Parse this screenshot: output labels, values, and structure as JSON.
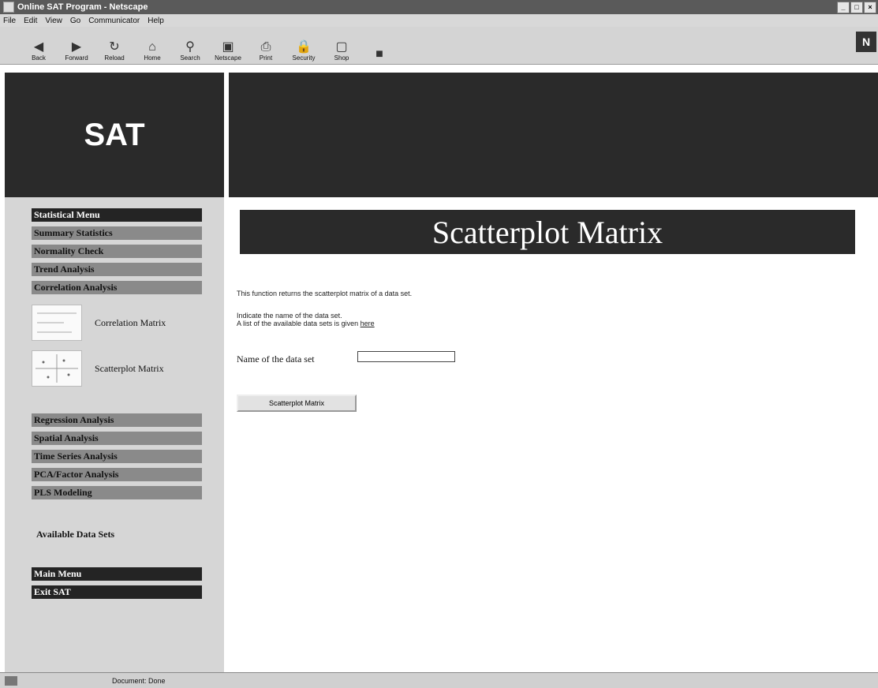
{
  "window": {
    "title": "Online SAT Program - Netscape"
  },
  "menu": [
    "File",
    "Edit",
    "View",
    "Go",
    "Communicator",
    "Help"
  ],
  "toolbar": [
    {
      "label": "Back",
      "icon": "back-arrow-icon"
    },
    {
      "label": "Forward",
      "icon": "forward-arrow-icon"
    },
    {
      "label": "Reload",
      "icon": "reload-icon"
    },
    {
      "label": "Home",
      "icon": "home-icon"
    },
    {
      "label": "Search",
      "icon": "search-icon"
    },
    {
      "label": "Netscape",
      "icon": "netscape-icon"
    },
    {
      "label": "Print",
      "icon": "print-icon"
    },
    {
      "label": "Security",
      "icon": "security-icon"
    },
    {
      "label": "Shop",
      "icon": "shop-icon"
    },
    {
      "label": "",
      "icon": "stop-icon"
    }
  ],
  "brand_logo": "N",
  "header": {
    "logo": "SAT"
  },
  "sidebar": {
    "menu_title": "Statistical Menu",
    "items": [
      "Summary Statistics",
      "Normality Check",
      "Trend Analysis",
      "Correlation Analysis"
    ],
    "sub_items": [
      "Correlation Matrix",
      "Scatterplot Matrix"
    ],
    "items_more": [
      "Regression Analysis",
      "Spatial Analysis",
      "Time Series Analysis",
      "PCA/Factor Analysis",
      "PLS Modeling"
    ],
    "available_label": "Available Data Sets",
    "bottom_items": [
      "Main Menu",
      "Exit SAT"
    ]
  },
  "main": {
    "title": "Scatterplot Matrix",
    "description": "This function returns the scatterplot matrix of a data set.",
    "instruction": "Indicate the name of the data set.",
    "list_text": "A list of the available data sets is given",
    "list_link": "here",
    "name_label": "Name of the data set",
    "name_value": "",
    "button_label": "Scatterplot Matrix"
  },
  "status": {
    "text": "Document: Done"
  },
  "colors": {
    "dark": "#2a2a2a",
    "sidebar": "#d6d6d6",
    "nav_gray": "#8a8a8a"
  }
}
